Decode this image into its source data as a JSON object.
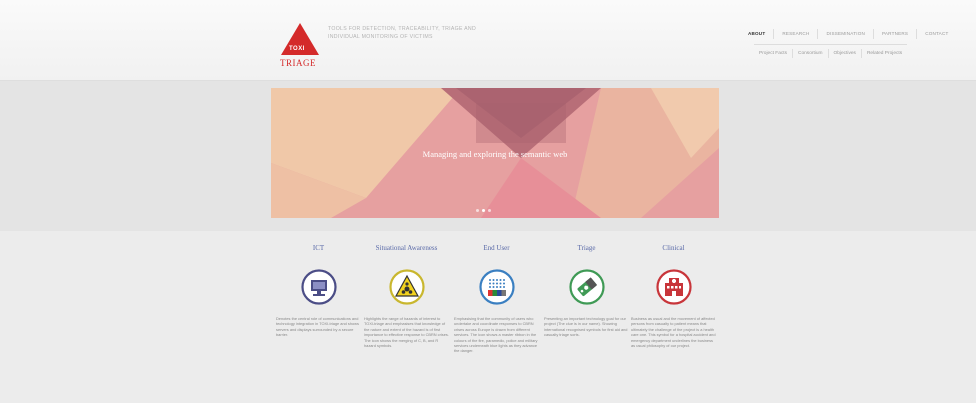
{
  "header": {
    "logo_line1": "TOXI",
    "logo_line2": "TRIAGE",
    "tagline": "TOOLS FOR DETECTION, TRACEABILITY, TRIAGE AND INDIVIDUAL MONITORING OF VICTIMS",
    "nav": [
      "ABOUT",
      "RESEARCH",
      "DISSEMINATION",
      "PARTNERS",
      "CONTACT"
    ],
    "subnav": [
      "Project Facts",
      "Consortium",
      "Objectives",
      "Related Projects"
    ]
  },
  "hero": {
    "slide_text": "Managing and exploring the semantic web",
    "active_slide": 1,
    "slide_count": 3
  },
  "features": [
    {
      "title": "ICT",
      "icon": "computer-monitor-icon",
      "color": "#4b4d86",
      "text": "Denotes the central role of communications and technology integration in TOXI-triage and shows servers and displays surrounded by a secure barrier."
    },
    {
      "title": "Situational Awareness",
      "icon": "hazard-warning-icon",
      "color": "#c9b72f",
      "text": "Highlights the range of hazards of interest to TOXI-triage and emphasises that knowledge of the nature and extent of the hazard is of first importance to effective response to CBRN crises. The icon shows the merging of C, B, and R hazard symbols."
    },
    {
      "title": "End User",
      "icon": "crowd-icon",
      "color": "#3a7fc1",
      "text": "Emphasising that the community of users who undertake and coordinate responses to CBRN crises across Europe is drawn from different services. The icon shows a master ribbon in the colours of the fire, paramedic, police and military services underneath blue lights as they advance the danger."
    },
    {
      "title": "Triage",
      "icon": "triage-tag-icon",
      "color": "#3f9a55",
      "text": "Presenting an important technology goal for our project (The clue is in our name). Showing international recognised symbols for first aid and casualty triage sorts."
    },
    {
      "title": "Clinical",
      "icon": "hospital-icon",
      "color": "#c8353a",
      "text": "Business as usual and the movement of affected persons from casualty to patient means that ultimately the challenge of the project is a health care one. This symbol for a hospital accident and emergency department underlines the business as usual philosophy of our project."
    }
  ],
  "colors": {
    "accent": "#d42a2a",
    "slider_base": "#e28d95",
    "feature_title": "#5a6aa8"
  }
}
